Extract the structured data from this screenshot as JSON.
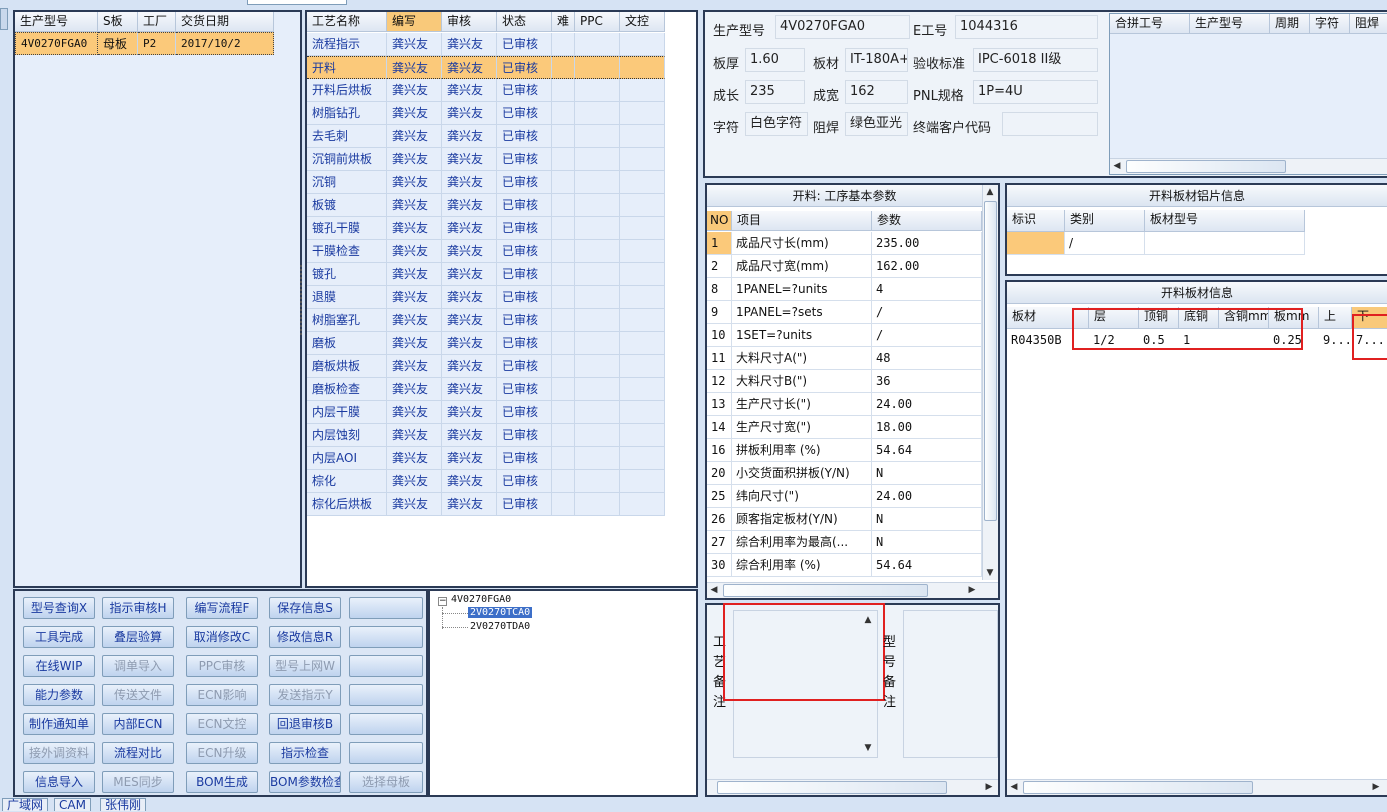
{
  "product_list": {
    "headers": [
      "生产型号",
      "S板",
      "工厂",
      "交货日期"
    ],
    "row": {
      "model": "4V0270FGA0",
      "board": "母板",
      "factory": "P2",
      "date": "2017/10/2"
    }
  },
  "process_table": {
    "headers": [
      "工艺名称",
      "编写",
      "审核",
      "状态",
      "难",
      "PPC",
      "文控"
    ],
    "rows": [
      {
        "name": "流程指示",
        "writer": "龚兴友",
        "reviewer": "龚兴友",
        "status": "已审核"
      },
      {
        "name": "开料",
        "writer": "龚兴友",
        "reviewer": "龚兴友",
        "status": "已审核"
      },
      {
        "name": "开料后烘板",
        "writer": "龚兴友",
        "reviewer": "龚兴友",
        "status": "已审核"
      },
      {
        "name": "树脂钻孔",
        "writer": "龚兴友",
        "reviewer": "龚兴友",
        "status": "已审核"
      },
      {
        "name": "去毛刺",
        "writer": "龚兴友",
        "reviewer": "龚兴友",
        "status": "已审核"
      },
      {
        "name": "沉铜前烘板",
        "writer": "龚兴友",
        "reviewer": "龚兴友",
        "status": "已审核"
      },
      {
        "name": "沉铜",
        "writer": "龚兴友",
        "reviewer": "龚兴友",
        "status": "已审核"
      },
      {
        "name": "板镀",
        "writer": "龚兴友",
        "reviewer": "龚兴友",
        "status": "已审核"
      },
      {
        "name": "镀孔干膜",
        "writer": "龚兴友",
        "reviewer": "龚兴友",
        "status": "已审核"
      },
      {
        "name": "干膜检查",
        "writer": "龚兴友",
        "reviewer": "龚兴友",
        "status": "已审核"
      },
      {
        "name": "镀孔",
        "writer": "龚兴友",
        "reviewer": "龚兴友",
        "status": "已审核"
      },
      {
        "name": "退膜",
        "writer": "龚兴友",
        "reviewer": "龚兴友",
        "status": "已审核"
      },
      {
        "name": "树脂塞孔",
        "writer": "龚兴友",
        "reviewer": "龚兴友",
        "status": "已审核"
      },
      {
        "name": "磨板",
        "writer": "龚兴友",
        "reviewer": "龚兴友",
        "status": "已审核"
      },
      {
        "name": "磨板烘板",
        "writer": "龚兴友",
        "reviewer": "龚兴友",
        "status": "已审核"
      },
      {
        "name": "磨板检查",
        "writer": "龚兴友",
        "reviewer": "龚兴友",
        "status": "已审核"
      },
      {
        "name": "内层干膜",
        "writer": "龚兴友",
        "reviewer": "龚兴友",
        "status": "已审核"
      },
      {
        "name": "内层蚀刻",
        "writer": "龚兴友",
        "reviewer": "龚兴友",
        "status": "已审核"
      },
      {
        "name": "内层AOI",
        "writer": "龚兴友",
        "reviewer": "龚兴友",
        "status": "已审核"
      },
      {
        "name": "棕化",
        "writer": "龚兴友",
        "reviewer": "龚兴友",
        "status": "已审核"
      },
      {
        "name": "棕化后烘板",
        "writer": "龚兴友",
        "reviewer": "龚兴友",
        "status": "已审核"
      }
    ]
  },
  "buttons": [
    [
      "型号查询X",
      "指示审核H",
      "编写流程F",
      "保存信息S",
      ""
    ],
    [
      "工具完成",
      "叠层验算",
      "取消修改C",
      "修改信息R",
      ""
    ],
    [
      "在线WIP",
      "调单导入",
      "PPC审核",
      "型号上网W",
      ""
    ],
    [
      "能力参数",
      "传送文件",
      "ECN影响",
      "发送指示Y",
      ""
    ],
    [
      "制作通知单",
      "内部ECN",
      "ECN文控",
      "回退审核B",
      ""
    ],
    [
      "接外调资料",
      "流程对比",
      "ECN升级",
      "指示检查",
      ""
    ],
    [
      "信息导入",
      "MES同步",
      "BOM生成",
      "BOM参数检查",
      "选择母板"
    ]
  ],
  "buttons_disabled": [
    [
      false,
      false,
      false,
      false,
      true
    ],
    [
      false,
      false,
      false,
      false,
      true
    ],
    [
      false,
      true,
      true,
      true,
      true
    ],
    [
      false,
      true,
      true,
      true,
      true
    ],
    [
      false,
      false,
      true,
      false,
      true
    ],
    [
      true,
      false,
      true,
      false,
      true
    ],
    [
      false,
      true,
      false,
      false,
      true
    ]
  ],
  "tree": {
    "root": "4V0270FGA0",
    "children": [
      "2V0270TCA0",
      "2V0270TDA0"
    ]
  },
  "info": {
    "model_label": "生产型号",
    "model": "4V0270FGA0",
    "eno_label": "E工号",
    "eno": "1044316",
    "thick_label": "板厚",
    "thick": "1.60",
    "material_label": "板材",
    "material": "IT-180A+",
    "std_label": "验收标准",
    "std": "IPC-6018 II级",
    "len_label": "成长",
    "len": "235",
    "wid_label": "成宽",
    "wid": "162",
    "pnl_label": "PNL规格",
    "pnl": "1P=4U",
    "char_label": "字符",
    "char": "白色字符",
    "mask_label": "阻焊",
    "mask": "绿色亚光",
    "cust_label": "终端客户代码",
    "cust": ""
  },
  "combined": {
    "headers": [
      "合拼工号",
      "生产型号",
      "周期",
      "字符",
      "阻焊"
    ]
  },
  "params": {
    "title": "开料: 工序基本参数",
    "headers": [
      "NO",
      "项目",
      "参数"
    ],
    "rows": [
      {
        "no": "1",
        "item": "成品尺寸长(mm)",
        "val": "235.00"
      },
      {
        "no": "2",
        "item": "成品尺寸宽(mm)",
        "val": "162.00"
      },
      {
        "no": "8",
        "item": "1PANEL=?units",
        "val": "4"
      },
      {
        "no": "9",
        "item": "1PANEL=?sets",
        "val": "/"
      },
      {
        "no": "10",
        "item": "1SET=?units",
        "val": "/"
      },
      {
        "no": "11",
        "item": "大料尺寸A(\")",
        "val": "48"
      },
      {
        "no": "12",
        "item": "大料尺寸B(\")",
        "val": "36"
      },
      {
        "no": "13",
        "item": "生产尺寸长(\")",
        "val": "24.00"
      },
      {
        "no": "14",
        "item": "生产尺寸宽(\")",
        "val": "18.00"
      },
      {
        "no": "16",
        "item": "拼板利用率 (%)",
        "val": "54.64"
      },
      {
        "no": "20",
        "item": "小交货面积拼板(Y/N)",
        "val": "N"
      },
      {
        "no": "25",
        "item": "纬向尺寸(\")",
        "val": "24.00"
      },
      {
        "no": "26",
        "item": "顾客指定板材(Y/N)",
        "val": "N"
      },
      {
        "no": "27",
        "item": "综合利用率为最高(...",
        "val": "N"
      },
      {
        "no": "30",
        "item": "综合利用率 (%)",
        "val": "54.64"
      }
    ]
  },
  "alu_sheet": {
    "title": "开料板材铝片信息",
    "headers": [
      "标识",
      "类别",
      "板材型号"
    ],
    "row": {
      "mark": "",
      "type": "/",
      "model": ""
    }
  },
  "sheet_info": {
    "title": "开料板材信息",
    "headers": [
      "板材",
      "层",
      "顶铜",
      "底铜",
      "含铜mm",
      "板mm",
      "上",
      "下"
    ],
    "row": {
      "material": "R04350B",
      "layer": "1/2",
      "top": "0.5",
      "bottom": "1",
      "cu": "",
      "board": "0.25",
      "up": "9...",
      "down": "7..."
    }
  },
  "remarks": {
    "process_label": "工艺备注",
    "model_label": "型号备注"
  },
  "tabs": [
    "广域网",
    "CAM",
    "张伟刚"
  ]
}
